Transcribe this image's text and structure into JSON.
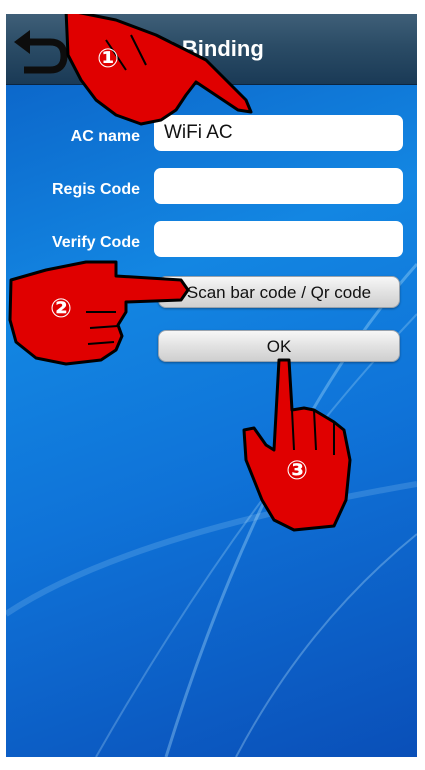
{
  "header": {
    "title": "AC Binding",
    "back_icon": "back-arrow-icon"
  },
  "form": {
    "ac_name_label": "AC name",
    "ac_name_value": "WiFi AC",
    "regis_code_label": "Regis Code",
    "regis_code_value": "",
    "verify_code_label": "Verify Code",
    "verify_code_value": ""
  },
  "buttons": {
    "scan_label": "Scan bar code / Qr code",
    "ok_label": "OK"
  },
  "annotations": {
    "step1": "①",
    "step2": "②",
    "step3": "③"
  },
  "colors": {
    "hand_fill": "#e00000",
    "hand_outline": "#000000",
    "header": "#2b4c66",
    "background": "#1386e2"
  }
}
